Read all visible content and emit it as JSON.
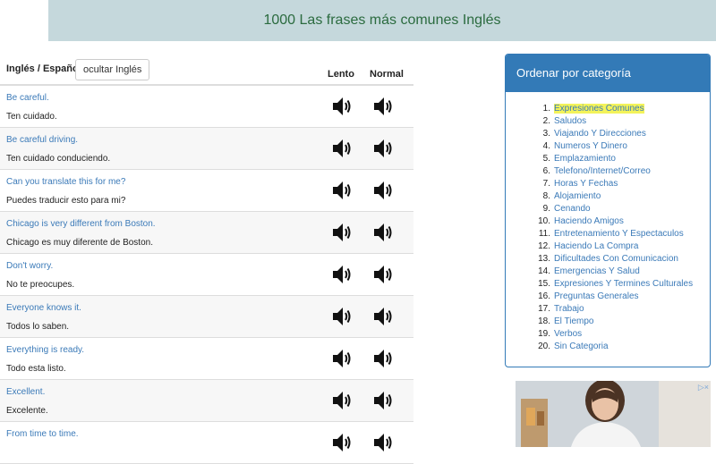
{
  "header": {
    "title": "1000 Las frases más comunes Inglés"
  },
  "phrases_table": {
    "lang_label": "Inglés / Español",
    "toggle_label": "ocultar Inglés",
    "col_slow": "Lento",
    "col_normal": "Normal",
    "rows": [
      {
        "en": "Be careful.",
        "es": "Ten cuidado."
      },
      {
        "en": "Be careful driving.",
        "es": "Ten cuidado conduciendo."
      },
      {
        "en": "Can you translate this for me?",
        "es": "Puedes traducir esto para mi?"
      },
      {
        "en": "Chicago is very different from Boston.",
        "es": "Chicago es muy diferente de Boston."
      },
      {
        "en": "Don't worry.",
        "es": "No te preocupes."
      },
      {
        "en": "Everyone knows it.",
        "es": "Todos lo saben."
      },
      {
        "en": "Everything is ready.",
        "es": "Todo esta listo."
      },
      {
        "en": "Excellent.",
        "es": "Excelente."
      },
      {
        "en": "From time to time.",
        "es": ""
      }
    ]
  },
  "categories": {
    "title": "Ordenar por categoría",
    "items": [
      {
        "num": "1.",
        "label": "Expresiones Comunes"
      },
      {
        "num": "2.",
        "label": "Saludos"
      },
      {
        "num": "3.",
        "label": "Viajando Y Direcciones"
      },
      {
        "num": "4.",
        "label": "Numeros Y Dinero"
      },
      {
        "num": "5.",
        "label": "Emplazamiento"
      },
      {
        "num": "6.",
        "label": "Telefono/Internet/Correo"
      },
      {
        "num": "7.",
        "label": "Horas Y Fechas"
      },
      {
        "num": "8.",
        "label": "Alojamiento"
      },
      {
        "num": "9.",
        "label": "Cenando"
      },
      {
        "num": "10.",
        "label": "Haciendo Amigos"
      },
      {
        "num": "11.",
        "label": "Entretenamiento Y Espectaculos"
      },
      {
        "num": "12.",
        "label": "Haciendo La Compra"
      },
      {
        "num": "13.",
        "label": "Dificultades Con Comunicacion"
      },
      {
        "num": "14.",
        "label": "Emergencias Y Salud"
      },
      {
        "num": "15.",
        "label": "Expresiones Y Termines Culturales"
      },
      {
        "num": "16.",
        "label": "Preguntas Generales"
      },
      {
        "num": "17.",
        "label": "Trabajo"
      },
      {
        "num": "18.",
        "label": "El Tiempo"
      },
      {
        "num": "19.",
        "label": "Verbos"
      },
      {
        "num": "20.",
        "label": "Sin Categoria"
      }
    ]
  },
  "icons": {
    "speaker": "speaker-icon",
    "ad_choices": "ad-choices-icon"
  },
  "colors": {
    "header_bg": "#c5d8dc",
    "header_text": "#2b6b3f",
    "link": "#3b7ab8",
    "panel_accent": "#337ab7",
    "highlight": "#f3f35a"
  }
}
